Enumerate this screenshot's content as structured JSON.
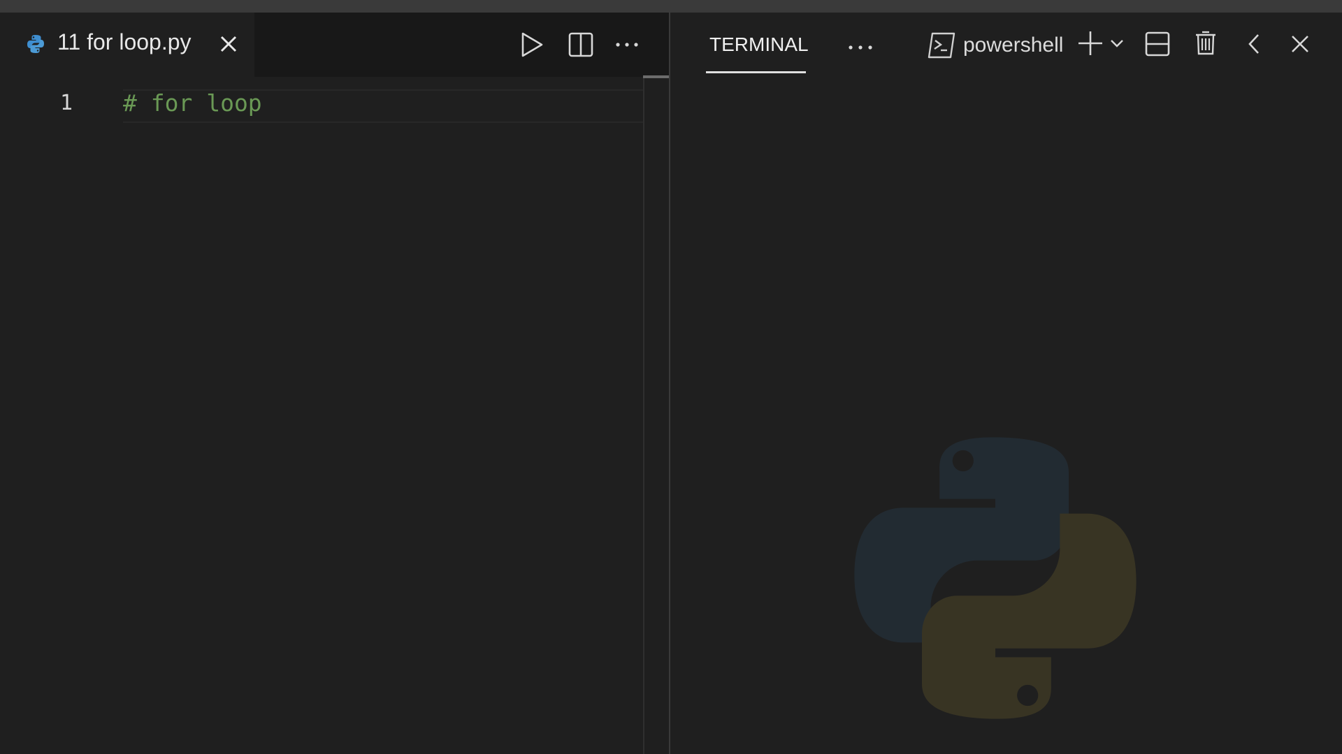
{
  "editor": {
    "tab": {
      "filename": "11 for loop.py",
      "icon": "python-file-icon"
    },
    "toolbar": {
      "run_icon": "run-play-icon",
      "split_icon": "split-editor-icon",
      "more_icon": "more-actions-icon"
    },
    "lines": [
      {
        "number": "1",
        "text": "# for loop"
      }
    ],
    "colors": {
      "comment": "#6a9955",
      "background": "#1f1f1f"
    }
  },
  "terminal": {
    "tab_label": "TERMINAL",
    "shell_label": "powershell",
    "icons": [
      "more-actions-icon",
      "terminal-shell-icon",
      "new-terminal-plus-icon",
      "chevron-down-icon",
      "split-terminal-icon",
      "trash-icon",
      "chevron-left-icon",
      "close-icon"
    ],
    "watermark": "python-logo-watermark"
  }
}
